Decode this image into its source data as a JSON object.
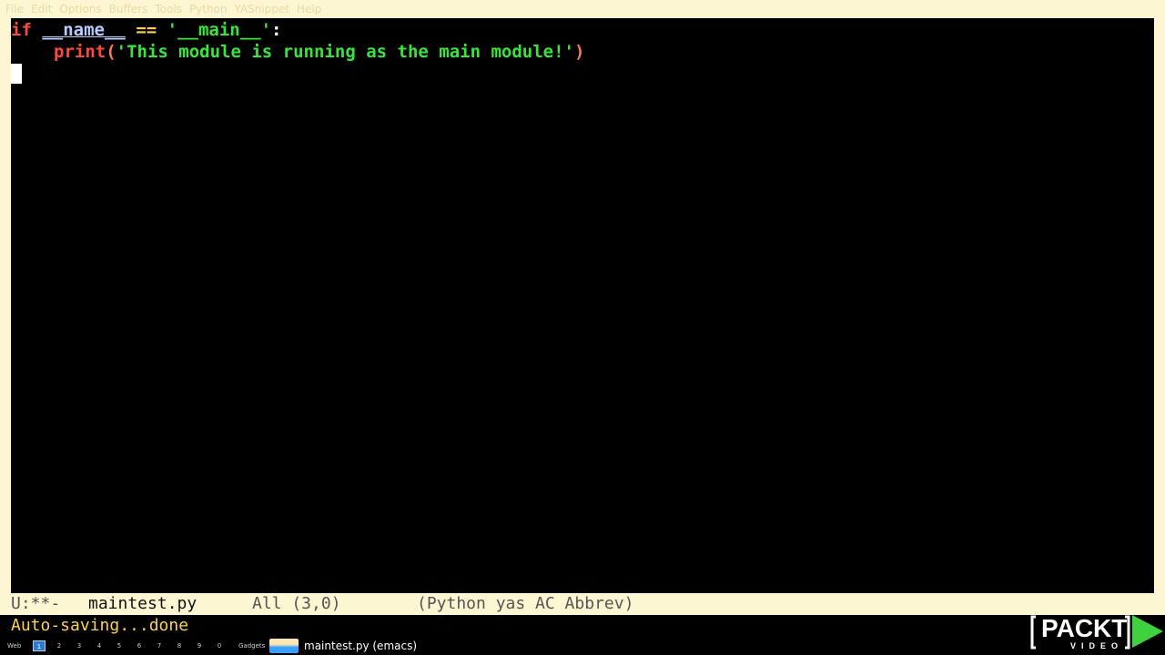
{
  "menu_bar": {
    "items": [
      "File",
      "Edit",
      "Options",
      "Buffers",
      "Tools",
      "Python",
      "YASnippet",
      "Help"
    ]
  },
  "editor": {
    "line1": {
      "keyword_if": "if",
      "identifier": "__name__",
      "operator": "==",
      "string": "'__main__'",
      "colon": ":"
    },
    "line2": {
      "builtin": "print",
      "open_paren": "(",
      "string": "'This module is running as the main module!'",
      "close_paren": ")"
    }
  },
  "mode_line": {
    "status": "U:**-",
    "buffer_name": "maintest.py",
    "position": "All (3,0)",
    "modes": "(Python yas AC Abbrev)"
  },
  "echo_area": {
    "message": "Auto-saving...done"
  },
  "taskbar": {
    "web_label": "Web",
    "workspaces": [
      "1",
      "2",
      "3",
      "4",
      "5",
      "6",
      "7",
      "8",
      "9",
      "0"
    ],
    "active_workspace": "1",
    "gadgets_label": "Gadgets",
    "window_title": "maintest.py (emacs)"
  },
  "logo": {
    "brand": "PACKT",
    "sub": "VIDEO"
  },
  "colors": {
    "keyword": "#ff4a3a",
    "identifier": "#b8ccff",
    "string": "#37e637",
    "operator": "#ffd24a",
    "echo": "#ffd24a",
    "modeline_bg": "#fdf6d2",
    "editor_bg": "#000000",
    "logo_green": "#3fd23f"
  }
}
